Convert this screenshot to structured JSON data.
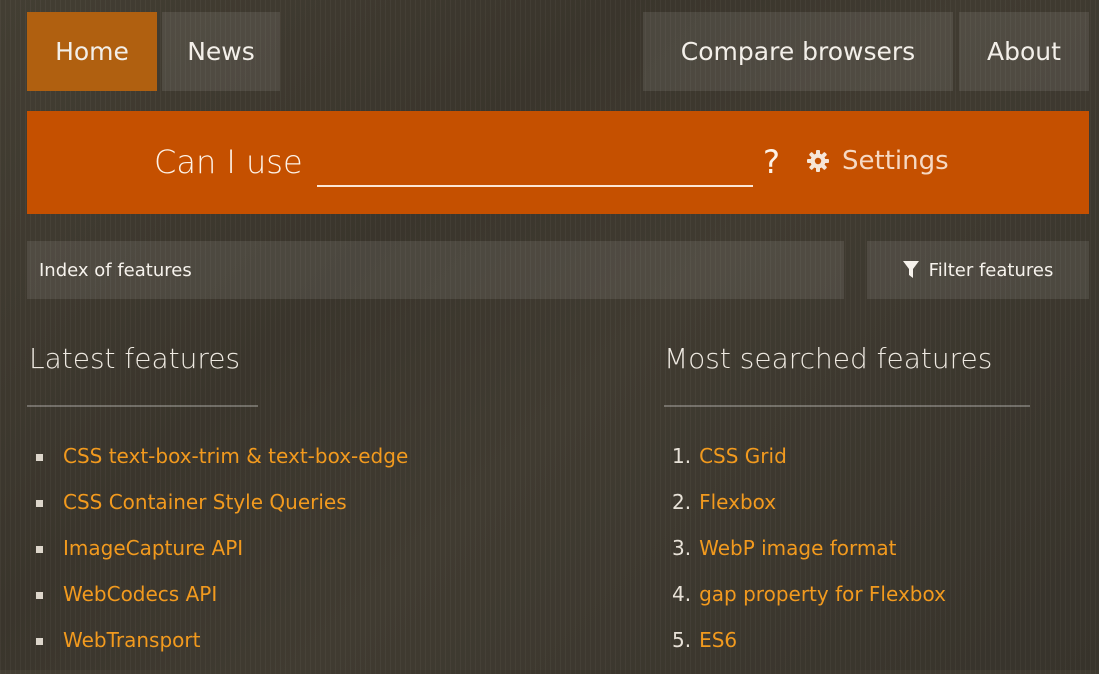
{
  "nav": {
    "home_label": "Home",
    "news_label": "News",
    "compare_label": "Compare browsers",
    "about_label": "About",
    "active_tab": "Home",
    "active_color": "#b06010"
  },
  "search": {
    "prefix": "Can I use",
    "value": "",
    "suffix": "?",
    "settings_label": "Settings",
    "settings_icon": "gear-icon",
    "bar_color": "#c55000"
  },
  "index": {
    "label": "Index of features",
    "filter_label": "Filter features",
    "filter_icon": "filter-funnel-icon"
  },
  "latest": {
    "heading": "Latest features",
    "items": [
      {
        "label": "CSS text-box-trim & text-box-edge"
      },
      {
        "label": "CSS Container Style Queries"
      },
      {
        "label": "ImageCapture API"
      },
      {
        "label": "WebCodecs API"
      },
      {
        "label": "WebTransport"
      }
    ]
  },
  "most_searched": {
    "heading": "Most searched features",
    "items": [
      {
        "rank": "1.",
        "label": "CSS Grid"
      },
      {
        "rank": "2.",
        "label": "Flexbox"
      },
      {
        "rank": "3.",
        "label": "WebP image format"
      },
      {
        "rank": "4.",
        "label": "gap property for Flexbox"
      },
      {
        "rank": "5.",
        "label": "ES6"
      }
    ]
  },
  "colors": {
    "link": "#f29a1e",
    "background": "#3f3b31"
  }
}
